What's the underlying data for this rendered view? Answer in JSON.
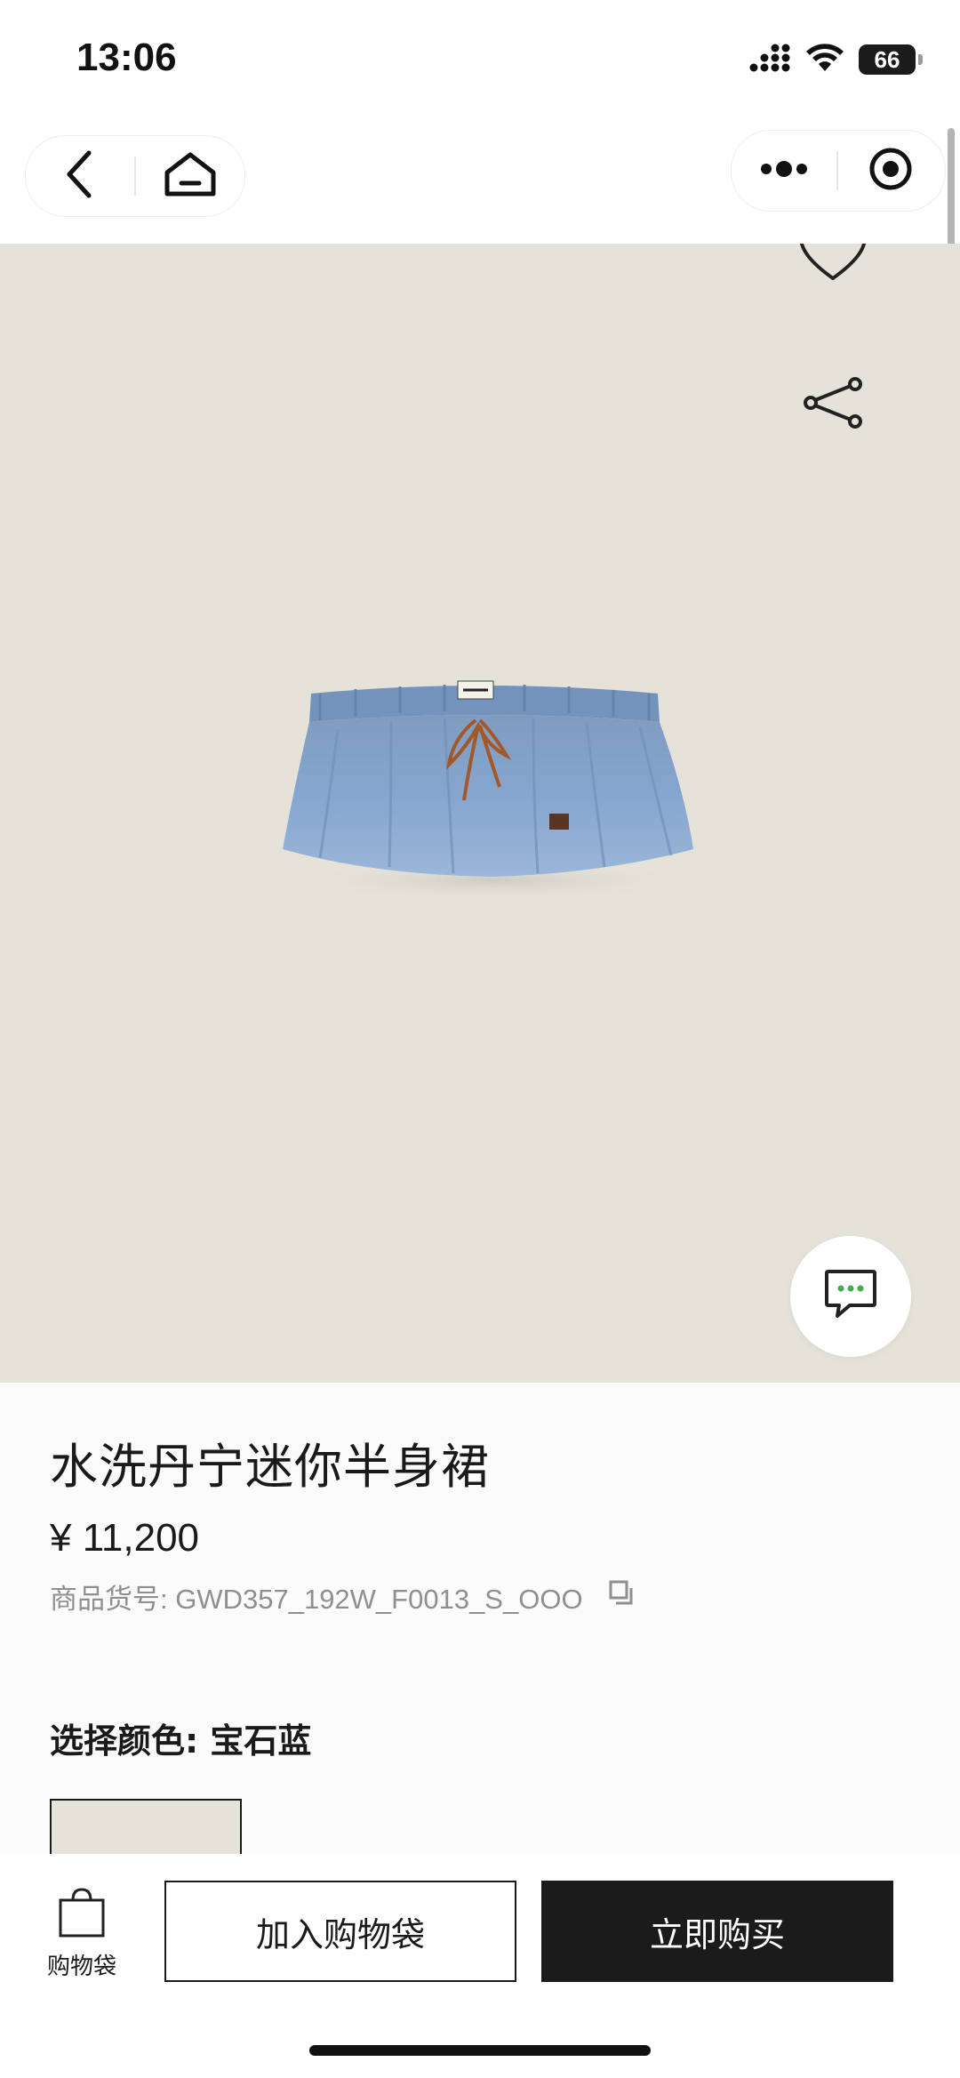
{
  "status_bar": {
    "time": "13:06",
    "battery": "66",
    "icons": [
      "signal-icon",
      "wifi-icon",
      "battery-icon"
    ]
  },
  "nav": {
    "left_icons": [
      "back-icon",
      "home-icon"
    ],
    "right_icons": [
      "more-icon",
      "target-icon"
    ]
  },
  "hero": {
    "background_color": "#e5e3d9",
    "image_subject": "denim mini skirt",
    "carousel_pages": 5,
    "carousel_active_index": 0,
    "actions": [
      "heart-icon",
      "share-icon",
      "chat-icon"
    ]
  },
  "product": {
    "title": "水洗丹宁迷你半身裙",
    "price": "¥ 11,200",
    "sku": "商品货号: GWD357_192W_F0013_S_OOO",
    "color_label": "选择颜色: 宝石蓝"
  },
  "actions": {
    "bag_label": "购物袋",
    "add_to_cart": "加入购物袋",
    "buy_now": "立即购买"
  },
  "colors": {
    "primary_dark": "#1b1b1b",
    "hero_bg": "#e5e3d9",
    "denim": "#7b9fc6"
  }
}
